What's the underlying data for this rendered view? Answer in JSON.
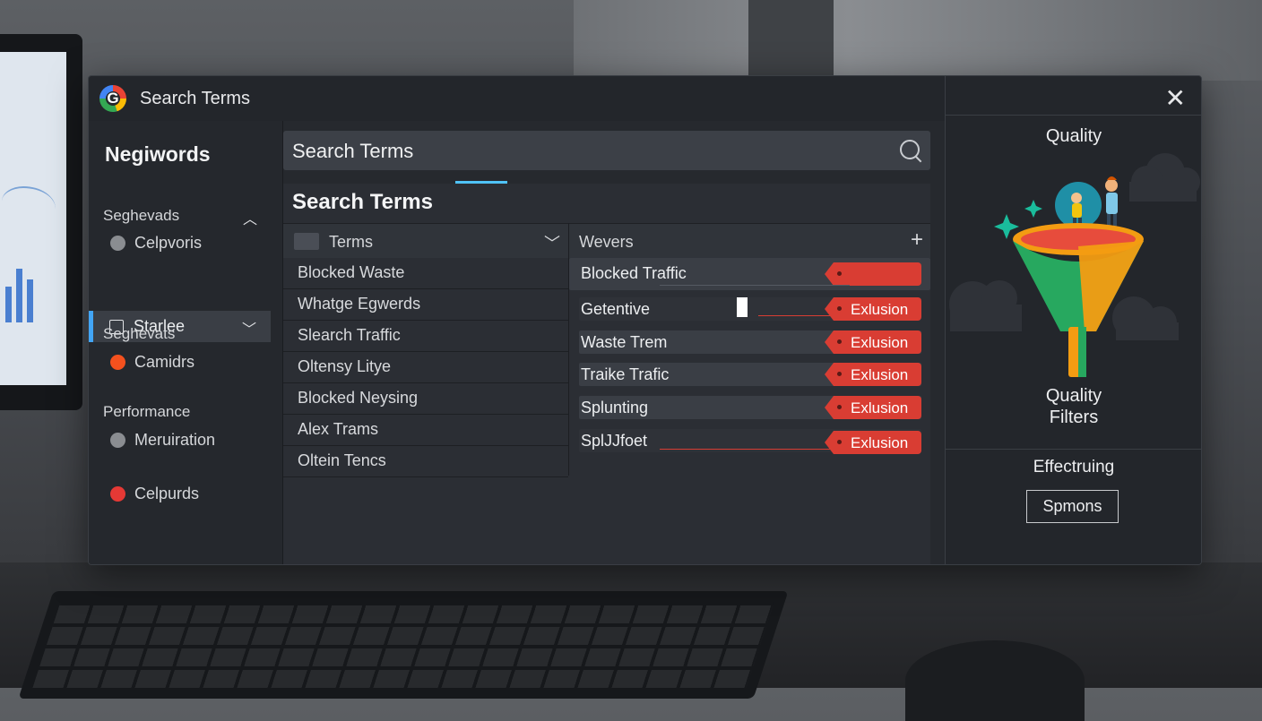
{
  "window": {
    "title": "Search Terms",
    "logo_letter": "G"
  },
  "sidebar": {
    "title": "Negiwords",
    "sections": [
      {
        "heading": "Seghevads",
        "item": "Celpvoris",
        "dot": "#8a8d91"
      },
      {
        "heading": "Seghevats",
        "item": "Camidrs",
        "dot": "#f4511e"
      },
      {
        "heading": "Performance",
        "item": "Meruiration",
        "dot": "#8a8d91"
      },
      {
        "heading": "",
        "item": "Celpurds",
        "dot": "#e53935"
      }
    ],
    "active_item": "Starlee"
  },
  "search": {
    "value": "Search Terms"
  },
  "panel": {
    "title": "Search Terms",
    "col_terms": "Terms",
    "col_waivers": "Wevers",
    "terms": [
      "Blocked Waste",
      "Whatge Egwerds",
      "Slearch Traffic",
      "Oltensy Litye",
      "Blocked Neysing",
      "Alex Trams",
      "Oltein Tencs"
    ],
    "waivers": [
      {
        "text": "Blocked Traffic",
        "tag": ""
      },
      {
        "text": "Getentive",
        "tag": "Exlusion"
      },
      {
        "text": "Waste Trem",
        "tag": "Exlusion"
      },
      {
        "text": "Traike Trafic",
        "tag": "Exlusion"
      },
      {
        "text": "Splunting",
        "tag": "Exlusion"
      },
      {
        "text": "SplJJfoet",
        "tag": "Exlusion"
      }
    ]
  },
  "right": {
    "heading": "Quality",
    "caption_line1": "Quality",
    "caption_line2": "Filters",
    "section": "Effectruing",
    "button": "Spmons"
  },
  "colors": {
    "accent": "#4fc3f7",
    "tag_red": "#d93d33",
    "funnel_orange": "#f39c12",
    "funnel_green": "#27a85f"
  }
}
